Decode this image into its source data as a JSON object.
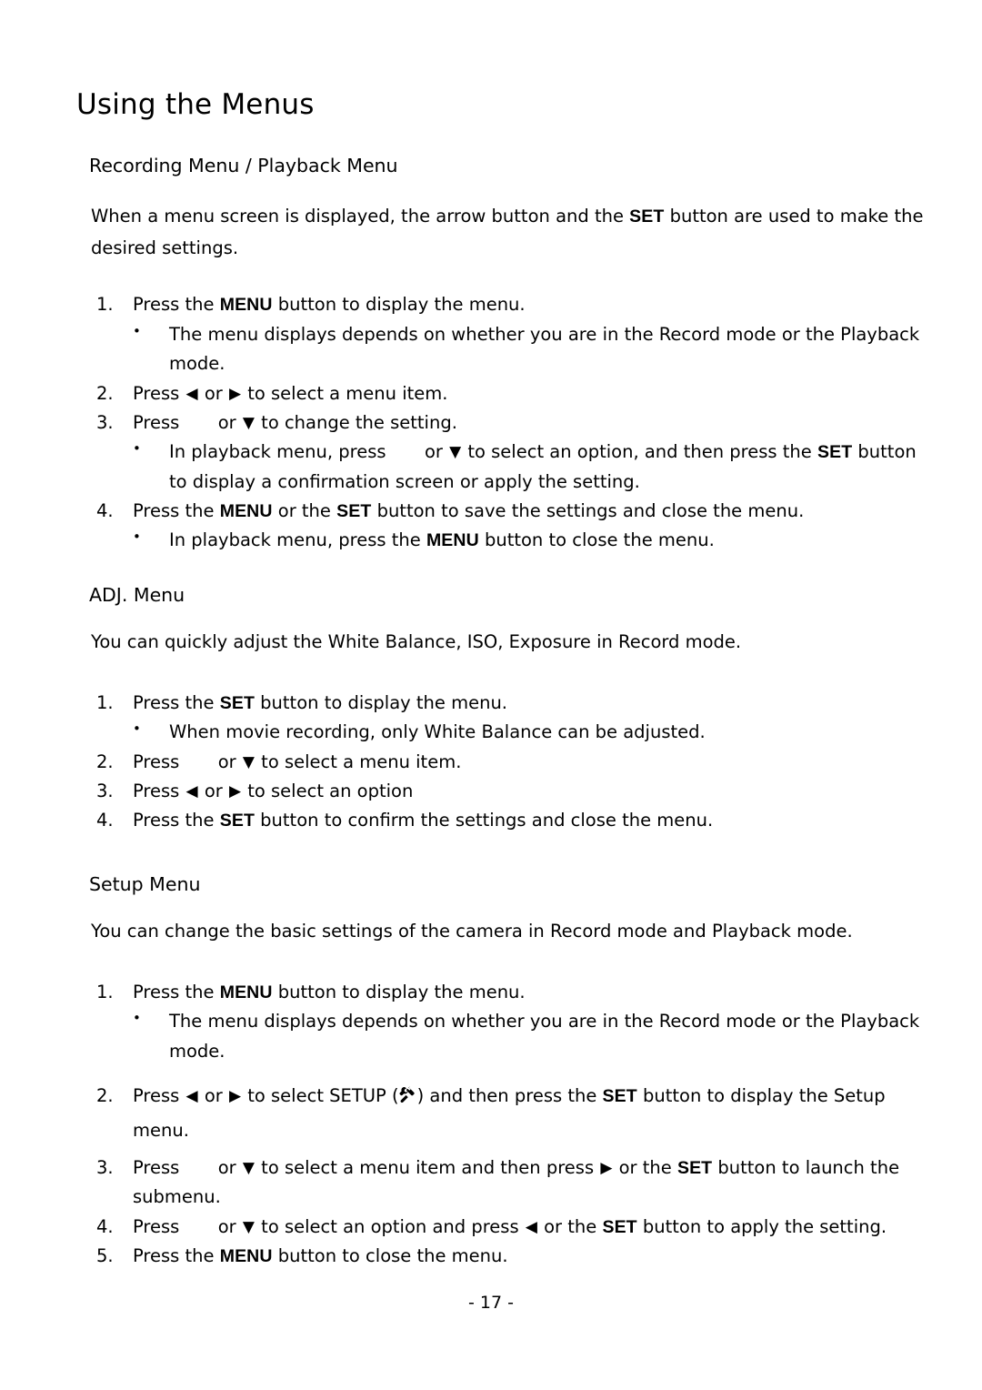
{
  "document": {
    "title": "Using the Menus",
    "page_number": "- 17 -"
  },
  "sections": [
    {
      "heading": "Recording Menu / Playback Menu",
      "intro": "When a menu screen is displayed, the arrow button and the SET button are used to make the desired settings.",
      "intro_parts": {
        "a": "When a menu screen is displayed, the arrow button and the",
        "kbd1": "SET",
        "b": "button are used to make the desired settings."
      },
      "steps": [
        {
          "num": "1.",
          "parts": {
            "a": "Press the",
            "kbd1": "MENU",
            "b": "button to display the menu."
          },
          "bullets": [
            "The menu displays depends on whether you are in the Record mode or the Playback mode."
          ]
        },
        {
          "num": "2.",
          "parts": {
            "a": "Press",
            "left_arrow": "◀",
            "b": "or",
            "right_arrow": "▶",
            "c": "to select a menu item."
          }
        },
        {
          "num": "3.",
          "parts": {
            "a": "Press",
            "up_arrow_missing": "",
            "b": "or",
            "down_arrow": "▼",
            "c": "to change the setting."
          },
          "bullets_rich": [
            {
              "a": "In playback menu, press",
              "up_arrow_missing": "",
              "b": "or",
              "down_arrow": "▼",
              "c": "to select an option, and then press the",
              "kbd1": "SET",
              "d": "button to display a confirmation screen or apply the setting."
            }
          ]
        },
        {
          "num": "4.",
          "parts": {
            "a": "Press the",
            "kbd1": "MENU",
            "b": "or the",
            "kbd2": "SET",
            "c": "button to save the settings and close the menu."
          },
          "bullets_rich2": [
            {
              "a": "In playback menu, press the",
              "kbd1": "MENU",
              "b": "button to close the menu."
            }
          ]
        }
      ]
    },
    {
      "heading": "ADJ. Menu",
      "intro": "You can quickly adjust the White Balance, ISO, Exposure in Record mode.",
      "steps": [
        {
          "num": "1.",
          "parts": {
            "a": "Press the",
            "kbd1": "SET",
            "b": "button to display the menu."
          },
          "bullets": [
            "When movie recording, only White Balance can be adjusted."
          ]
        },
        {
          "num": "2.",
          "parts": {
            "a": "Press",
            "up_arrow_missing": "",
            "b": "or",
            "down_arrow": "▼",
            "c": "to select a menu item."
          }
        },
        {
          "num": "3.",
          "parts": {
            "a": "Press",
            "left_arrow": "◀",
            "b": "or",
            "right_arrow": "▶",
            "c": "to select an option"
          }
        },
        {
          "num": "4.",
          "parts": {
            "a": "Press the",
            "kbd1": "SET",
            "b": "button to confirm the settings and close the menu."
          }
        }
      ]
    },
    {
      "heading": "Setup Menu",
      "intro": "You can change the basic settings of the camera in Record mode and Playback mode.",
      "steps": [
        {
          "num": "1.",
          "parts": {
            "a": "Press the",
            "kbd1": "MENU",
            "b": "button to display the menu."
          },
          "bullets": [
            "The menu displays depends on whether you are in the Record mode or the Playback mode."
          ]
        },
        {
          "num": "2.",
          "parts": {
            "a": "Press",
            "left_arrow": "◀",
            "b": "or",
            "right_arrow": "▶",
            "c": "to select SETUP (",
            "icon": "tools-icon",
            "d": ") and then press the",
            "kbd1": "SET",
            "e": "button to display the Setup menu."
          }
        },
        {
          "num": "3.",
          "parts": {
            "a": "Press",
            "up_arrow_missing": "",
            "b": "or",
            "down_arrow": "▼",
            "c": "to select a menu item and then press",
            "right_arrow": "▶",
            "d": "or the",
            "kbd1": "SET",
            "e": "button to launch the submenu."
          }
        },
        {
          "num": "4.",
          "parts": {
            "a": "Press",
            "up_arrow_missing": "",
            "b": "or",
            "down_arrow": "▼",
            "c": "to select an option and press",
            "left_arrow": "◀",
            "d": "or the",
            "kbd1": "SET",
            "e": "button to apply the setting."
          }
        },
        {
          "num": "5.",
          "parts": {
            "a": "Press the",
            "kbd1": "MENU",
            "b": "button to close the menu."
          }
        }
      ]
    }
  ],
  "icons": {
    "left_arrow": "◀",
    "right_arrow": "▶",
    "down_arrow": "▼",
    "bullet_dot": "•"
  },
  "colors": {
    "text": "#000000",
    "background": "#ffffff"
  }
}
